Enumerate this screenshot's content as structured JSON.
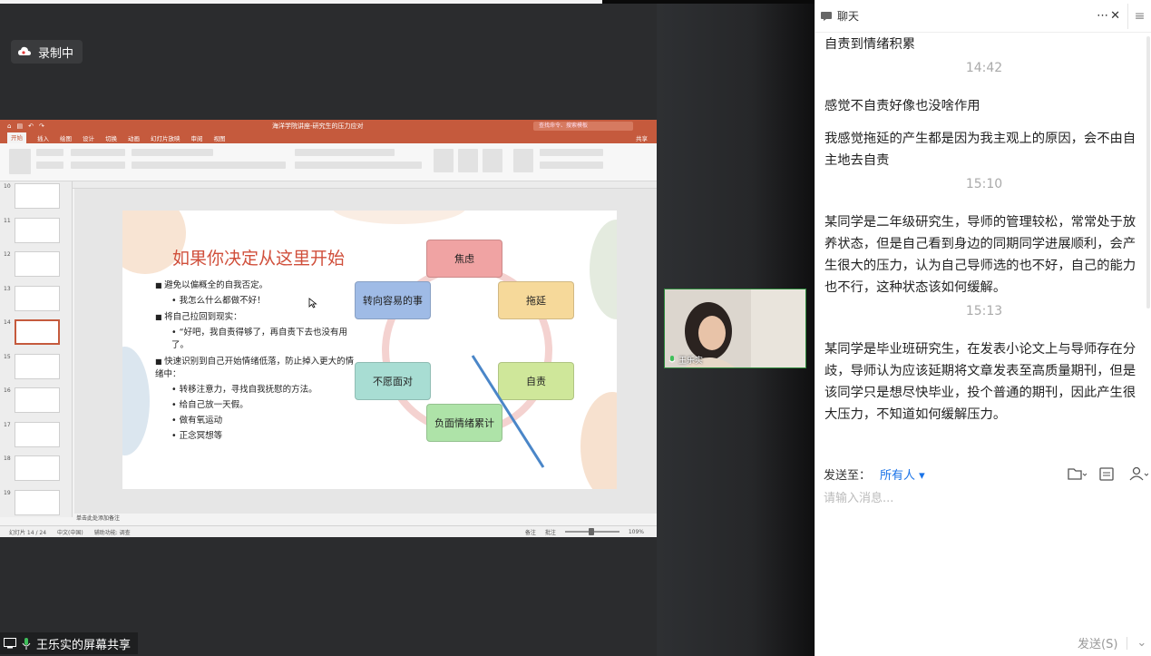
{
  "recording": {
    "label": "录制中"
  },
  "ppt": {
    "quick_access": [
      "⌂",
      "▤",
      "↶",
      "↷"
    ],
    "doc_title": "海洋学院讲座-研究生的压力应对",
    "search_placeholder": "查找命令、搜索模板",
    "tabs": [
      "开始",
      "插入",
      "绘图",
      "设计",
      "切换",
      "动画",
      "幻灯片放映",
      "审阅",
      "视图"
    ],
    "share": "共享",
    "thumb_numbers": [
      "10",
      "11",
      "12",
      "13",
      "14",
      "15",
      "16",
      "17",
      "18",
      "19"
    ],
    "notes_placeholder": "单击此处添加备注",
    "status_left": [
      "幻灯片 14 / 24",
      "中文(中国)",
      "辅助功能: 调查"
    ],
    "status_right": [
      "备注",
      "批注",
      "109%"
    ]
  },
  "slide": {
    "title": "如果你决定从这里开始",
    "bullets": [
      {
        "level": 1,
        "text": "避免以偏概全的自我否定。"
      },
      {
        "level": 2,
        "text": "我怎么什么都做不好！"
      },
      {
        "level": 1,
        "text": "将自己拉回到现实："
      },
      {
        "level": 2,
        "text": "“好吧，我自责得够了，再自责下去也没有用了。"
      },
      {
        "level": 1,
        "text": "快速识别到自己开始情绪低落，防止掉入更大的情绪中："
      },
      {
        "level": 2,
        "text": "转移注意力，寻找自我抚慰的方法。"
      },
      {
        "level": 2,
        "text": "给自己放一天假。"
      },
      {
        "level": 2,
        "text": "做有氧运动"
      },
      {
        "level": 2,
        "text": "正念冥想等"
      }
    ],
    "nodes": [
      "焦虑",
      "拖延",
      "自责",
      "负面情绪累计",
      "不愿面对",
      "转向容易的事"
    ]
  },
  "camera": {
    "name": "王乐实"
  },
  "screen_share": {
    "label": "王乐实的屏幕共享"
  },
  "chat": {
    "title": "聊天",
    "messages": [
      {
        "type": "text",
        "text": "自责到情绪积累"
      },
      {
        "type": "time",
        "text": "14:42"
      },
      {
        "type": "text",
        "text": "感觉不自责好像也没啥作用"
      },
      {
        "type": "text",
        "text": "我感觉拖延的产生都是因为我主观上的原因，会不由自主地去自责"
      },
      {
        "type": "time",
        "text": "15:10"
      },
      {
        "type": "text",
        "text": "某同学是二年级研究生，导师的管理较松，常常处于放养状态，但是自己看到身边的同期同学进展顺利，会产生很大的压力，认为自己导师选的也不好，自己的能力也不行，这种状态该如何缓解。"
      },
      {
        "type": "time",
        "text": "15:13"
      },
      {
        "type": "text",
        "text": "某同学是毕业班研究生，在发表小论文上与导师存在分歧，导师认为应该延期将文章发表至高质量期刊，但是该同学只是想尽快毕业，投个普通的期刊，因此产生很大压力，不知道如何缓解压力。"
      }
    ],
    "send_to_label": "发送至：",
    "send_to_value": "所有人 ▾",
    "input_placeholder": "请输入消息...",
    "send_button": "发送(S)"
  },
  "colors": {
    "ppt_accent": "#c55a3d",
    "link": "#1a73e8",
    "cam_border": "#2d8a3c"
  }
}
